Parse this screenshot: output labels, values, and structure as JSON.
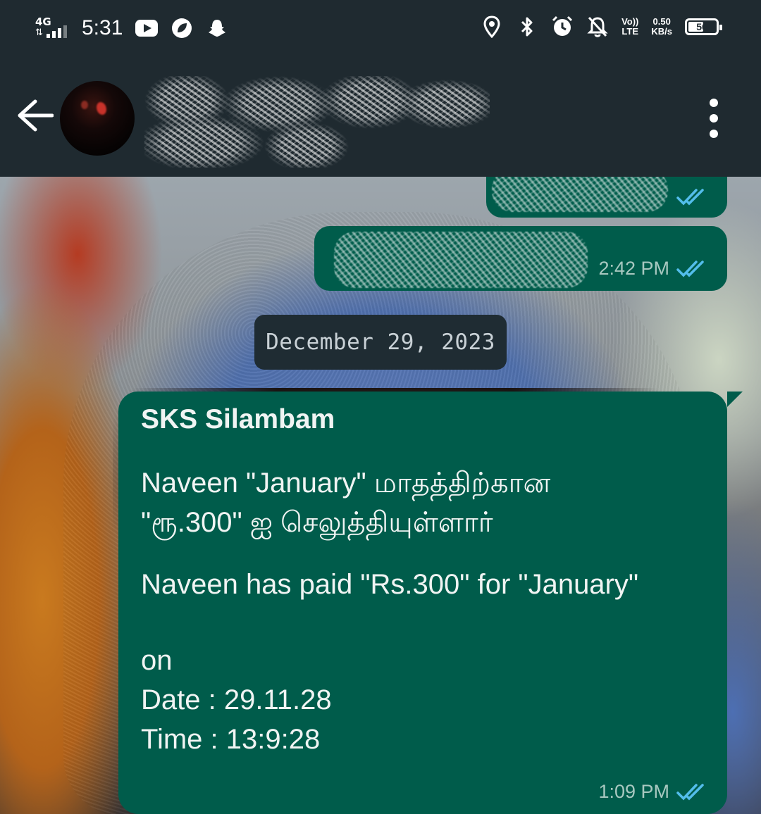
{
  "status_bar": {
    "network": "4G",
    "time": "5:31",
    "volte_top": "Vo))",
    "volte_bottom": "LTE",
    "speed_value": "0.50",
    "speed_unit": "KB/s",
    "battery": "56",
    "battery_level": 0.56
  },
  "header": {
    "contact_name_redacted": true
  },
  "messages": [
    {
      "direction": "out",
      "text_redacted": true,
      "time": "",
      "status": "read"
    },
    {
      "direction": "out",
      "text_redacted": true,
      "time": "2:42 PM",
      "status": "read"
    }
  ],
  "date_separator": "December 29, 2023",
  "main_message": {
    "sender": "SKS Silambam",
    "tamil_line_1": "Naveen \"January\" மாதத்திற்கான",
    "tamil_line_2": "\"ரூ.300\" ஐ செலுத்தியுள்ளார்",
    "english_line": "Naveen has paid \"Rs.300\" for \"January\"",
    "on_label": "on",
    "date_line": "Date : 29.11.28",
    "time_line": "Time : 13:9:28",
    "sent_time": "1:09 PM",
    "status": "read"
  },
  "colors": {
    "header_bg": "#1f2a30",
    "outgoing_bubble": "#005c4b",
    "read_tick": "#53bdeb",
    "date_chip": "#1f2c33"
  }
}
